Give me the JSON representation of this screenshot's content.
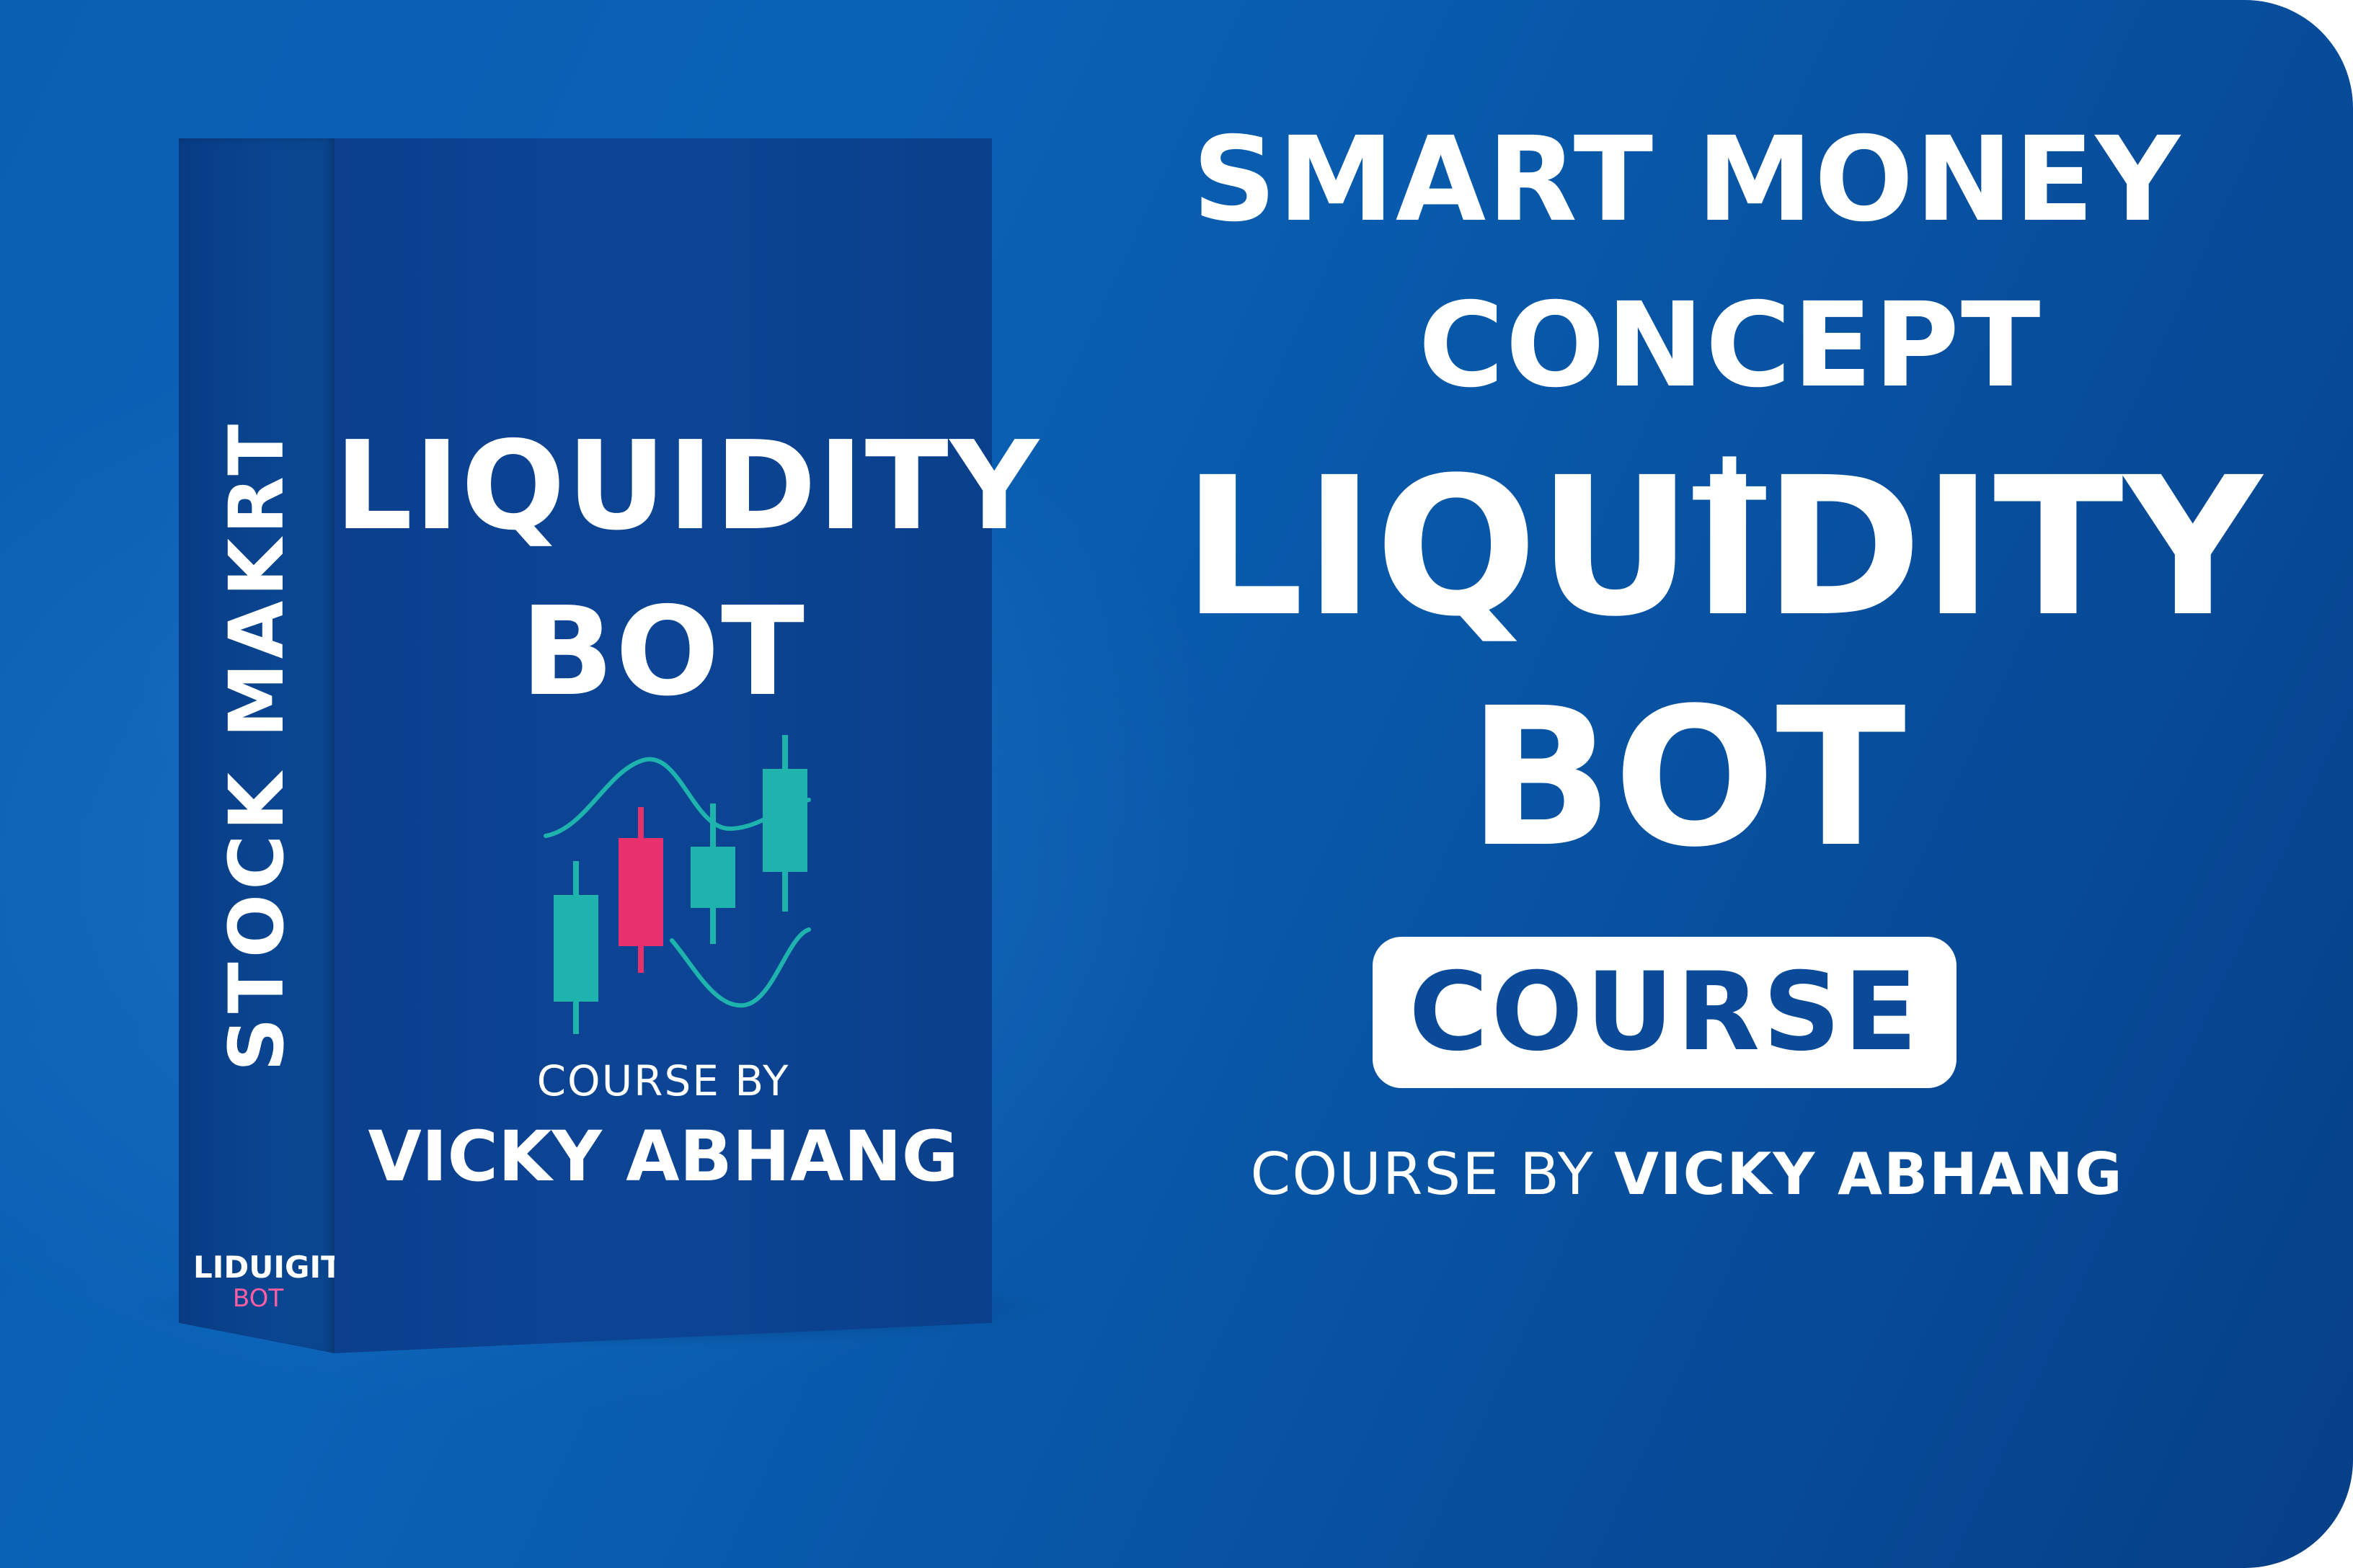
{
  "box": {
    "spine_text": "STOCK MAKRT",
    "spine_logo_line1": "LIDUIGITY",
    "spine_logo_line2": "BOT",
    "front_title_line1": "LIQUIDITY",
    "front_title_line2": "BOT",
    "front_byline": "COURSE BY",
    "front_author": "VICKY ABHANG",
    "chart_icon": "candlestick-chart-icon"
  },
  "headline": {
    "line1": "SMART MONEY",
    "line2": "CONCEPT +",
    "big_line1": "LIQUIDITY",
    "big_line2": "BOT",
    "pill_label": "COURSE",
    "byline_prefix": "COURSE BY",
    "byline_author": "VICKY ABHANG"
  },
  "colors": {
    "background": "#0a5fb2",
    "box_front": "#0c4595",
    "candle_teal": "#1fb3ad",
    "candle_pink": "#e8306e",
    "pill_text": "#0a4a99",
    "spine_logo_accent": "#ff5fa2"
  }
}
